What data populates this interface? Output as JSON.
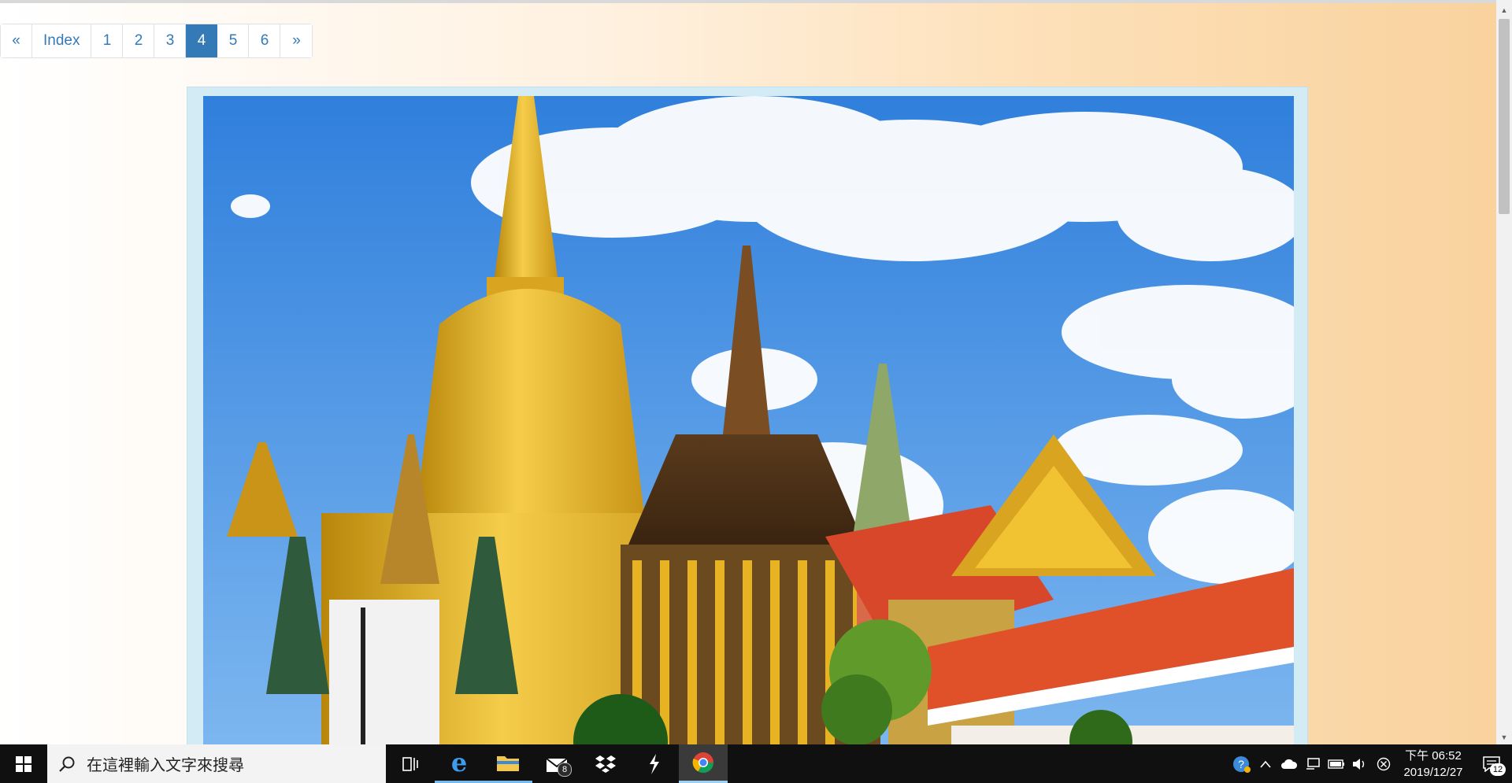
{
  "pagination": {
    "prev": "«",
    "index": "Index",
    "pages": [
      "1",
      "2",
      "3",
      "4",
      "5",
      "6"
    ],
    "active_page": "4",
    "next": "»"
  },
  "photo": {
    "icon": "temple-photo",
    "colors": {
      "sky": "#3e8fe6",
      "cloud": "#ffffff",
      "gold": "#e8b323",
      "roof": "#e0512a",
      "frame": "#d3ebf5"
    }
  },
  "taskbar": {
    "search_placeholder": "在這裡輸入文字來搜尋",
    "mail_badge": "8",
    "clock_time": "下午 06:52",
    "clock_date": "2019/12/27",
    "notification_count": "12"
  },
  "colors": {
    "accent": "#337ab7",
    "taskbar": "#101010"
  }
}
